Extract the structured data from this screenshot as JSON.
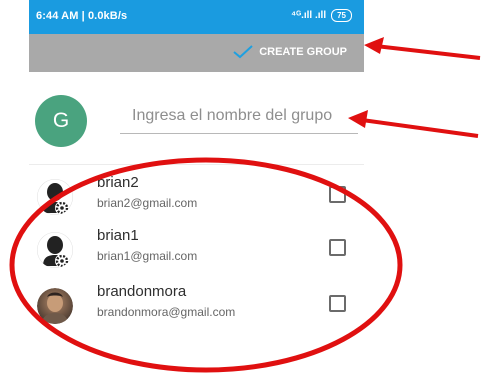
{
  "status_bar": {
    "left_text": "6:44 AM | 0.0kB/s",
    "signal": "⁴ᴳ.ıll .ıll",
    "battery": "75"
  },
  "toolbar": {
    "create_label": "CREATE GROUP"
  },
  "group": {
    "avatar_letter": "G",
    "name_placeholder": "Ingresa el nombre del grupo"
  },
  "contacts": [
    {
      "name": "brian2",
      "email": "brian2@gmail.com"
    },
    {
      "name": "brian1",
      "email": "brian1@gmail.com"
    },
    {
      "name": "brandonmora",
      "email": "brandonmora@gmail.com"
    }
  ],
  "colors": {
    "status_bar": "#1a9be0",
    "toolbar": "#a9a9a9",
    "avatar": "#4aa37f",
    "annotation": "#e01010"
  }
}
